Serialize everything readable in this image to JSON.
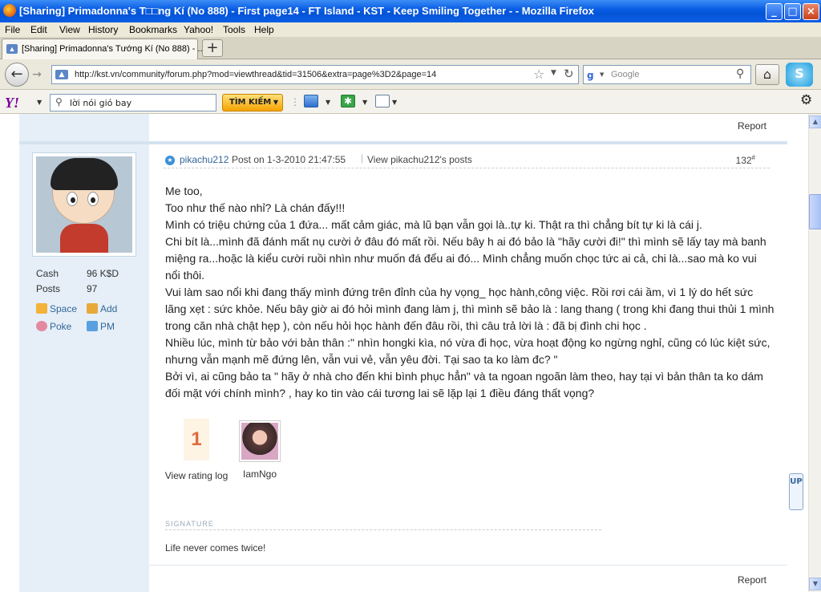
{
  "window": {
    "title": "[Sharing] Primadonna's T□□ng Kí (No 888) - First page14 - FT Island - KST - Keep Smiling Together - - Mozilla Firefox",
    "minimize": "_",
    "maximize": "□",
    "close": "×"
  },
  "menu": [
    "File",
    "Edit",
    "View",
    "History",
    "Bookmarks",
    "Yahoo!",
    "Tools",
    "Help"
  ],
  "tab": {
    "label": "[Sharing] Primadonna's Tướng Kí (No 888) - ...",
    "new_tab": "+"
  },
  "nav": {
    "url": "http://kst.vn/community/forum.php?mod=viewthread&tid=31506&extra=page%3D2&page=14",
    "search_placeholder": "Google",
    "search_engine_icon": "google-icon"
  },
  "yahoo_toolbar": {
    "logo": "Y!",
    "search_value": "lời nói gió bay",
    "search_button": "TÌM KIẾM"
  },
  "report_top": "Report",
  "report_bottom": "Report",
  "user": {
    "stats": [
      {
        "key": "Cash",
        "value": "96 K$D"
      },
      {
        "key": "Posts",
        "value": "97"
      }
    ],
    "links": [
      {
        "label": "Space",
        "icon": "home-icon"
      },
      {
        "label": "Add",
        "icon": "add-friend-icon"
      },
      {
        "label": "Poke",
        "icon": "poke-icon"
      },
      {
        "label": "PM",
        "icon": "mail-icon"
      }
    ]
  },
  "post": {
    "author": "pikachu212",
    "time": "Post on 1-3-2010 21:47:55",
    "view_posts": "View pikachu212's posts",
    "number": "132",
    "number_suffix": "#",
    "body": [
      "Me too,",
      "Too như thế nào nhỉ? Là chán đấy!!!",
      "Mình có triệu chứng của 1 đứa... mất cảm giác, mà lũ bạn vẫn gọi là..tự ki. Thật ra thì chẳng bít tự ki là cái j.",
      "Chi bít là...mình đã đánh mất nụ cười ở đâu đó mất rồi. Nếu bây h ai đó bảo là \"hãy cười đi!\" thì mình sẽ lấy tay mà banh miệng ra...hoặc là kiểu cười ruồi nhìn như muốn đá đểu ai đó... Mình chẳng muốn chọc tức ai cả, chi là...sao mà ko vui nổi thôi.",
      "Vui làm sao nổi khi đang thấy mình đứng trên đỉnh của hy vọng_ học hành,công việc. Rồi rơi cái ầm, vì 1 lý do hết sức lãng xẹt : sức khỏe. Nếu bây giờ ai đó hỏi mình đang làm j, thì mình sẽ bảo là : lang thang ( trong khi đang thui thủi 1 mình trong căn nhà chật hẹp ), còn nếu hỏi học hành đến đâu rồi, thì câu trả lời là : đã bị đình chi học .",
      "Nhiều lúc, mình từ bảo với bản thân :\" nhìn hongki kìa, nó vừa đi học, vừa hoạt động ko ngừng nghỉ, cũng có lúc kiệt sức, nhưng vẫn mạnh mẽ đứng lên, vẫn vui vẻ, vẫn yêu đời. Tại sao ta ko làm đc? \"",
      "Bởi vì, ai cũng bảo ta \" hãy ở nhà cho đến khi bình phục hẳn\" và ta ngoan ngoãn làm theo, hay tại vì bản thân ta ko dám đối mặt với chính mình? , hay ko tin vào cái tương lai sẽ lặp lại 1 điều đáng thất vọng?"
    ],
    "rating": {
      "value": "1",
      "label": "View rating log"
    },
    "rater": "IamNgo",
    "signature_label": "SIGNATURE",
    "signature": "Life never comes twice!"
  },
  "up_dock": "UP"
}
